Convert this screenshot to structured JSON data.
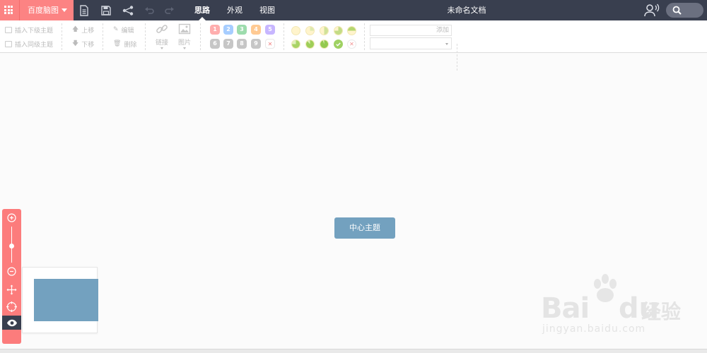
{
  "topbar": {
    "brand_label": "百度脑图",
    "tabs": [
      {
        "label": "思路",
        "active": true
      },
      {
        "label": "外观",
        "active": false
      },
      {
        "label": "视图",
        "active": false
      }
    ],
    "document_title": "未命名文档",
    "icons": [
      "apps-grid-icon",
      "new-file-icon",
      "save-icon",
      "share-icon",
      "undo-icon",
      "redo-icon",
      "user-voice-icon",
      "search-icon"
    ]
  },
  "toolbar": {
    "insert_child": "插入下级主题",
    "insert_sibling": "插入同级主题",
    "move_up": "上移",
    "move_down": "下移",
    "edit": "编辑",
    "delete": "删除",
    "link": "链接",
    "image": "图片",
    "priorities_row1": [
      "1",
      "2",
      "3",
      "4",
      "5"
    ],
    "priorities_row2": [
      "6",
      "7",
      "8",
      "9"
    ],
    "priority_remove": "✕",
    "progress_remove": "✕",
    "tag_add": "添加",
    "tag_select_value": ""
  },
  "colors": {
    "topbar_bg": "#393f4f",
    "brand_bg": "#fc8383",
    "center_node_bg": "#73a1bf",
    "priority": [
      "#ff6c6c",
      "#5fa6ff",
      "#4ec06b",
      "#ff9f3b",
      "#9b7cff",
      "#999999",
      "#999999",
      "#999999",
      "#999999"
    ]
  },
  "canvas": {
    "center_topic": "中心主题"
  },
  "navigator": {
    "buttons": [
      "zoom-in-icon",
      "zoom-out-icon",
      "move-icon",
      "locate-icon",
      "eye-icon"
    ],
    "zoom_level": 0.5
  },
  "watermark": {
    "text_bai": "Bai",
    "text_du": "du",
    "text_cn": "经验",
    "url": "jingyan.baidu.com"
  }
}
